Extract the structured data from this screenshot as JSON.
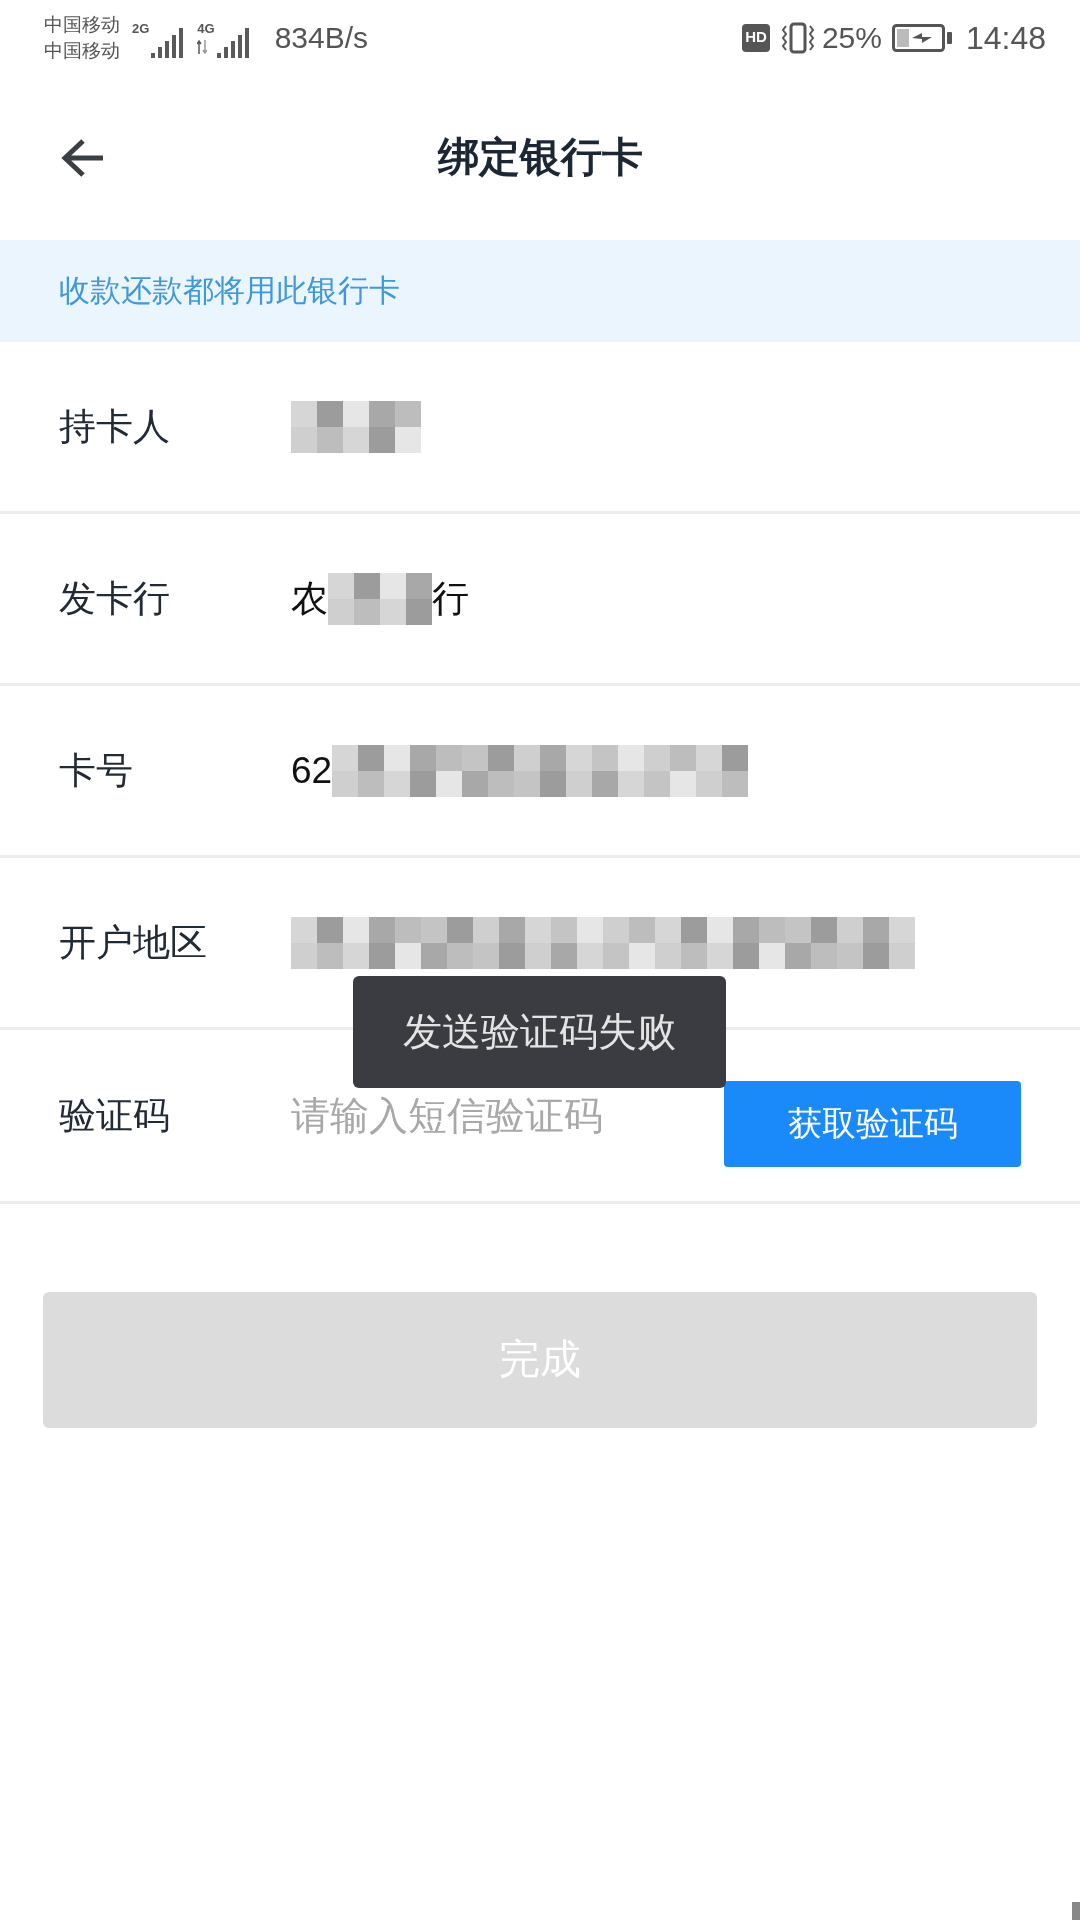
{
  "status_bar": {
    "carriers": [
      "中国移动",
      "中国移动"
    ],
    "networks": [
      {
        "type": "2G",
        "kind": "plain"
      },
      {
        "type": "4G",
        "kind": "data"
      }
    ],
    "speed": "834B/s",
    "hd": "HD",
    "battery_percent": "25%",
    "time": "14:48"
  },
  "header": {
    "title": "绑定银行卡"
  },
  "notice": "收款还款都将用此银行卡",
  "fields": [
    {
      "kind": "info",
      "label": "持卡人",
      "redacted": true
    },
    {
      "kind": "info",
      "label": "发卡行",
      "value_before": "农",
      "value_after": "行",
      "redacted": true
    },
    {
      "kind": "info",
      "label": "卡号",
      "value_before": "62",
      "redacted": true
    },
    {
      "kind": "info",
      "label": "开户地区",
      "redacted": true
    },
    {
      "kind": "code",
      "label": "验证码",
      "placeholder": "请输入短信验证码",
      "button": "获取验证码"
    }
  ],
  "toast": "发送验证码失败",
  "submit": {
    "label": "完成",
    "disabled": true
  }
}
